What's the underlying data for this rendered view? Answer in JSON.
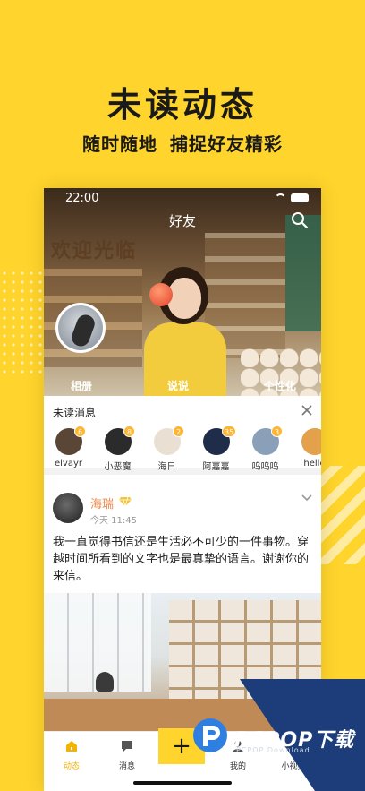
{
  "hero": {
    "title": "未读动态",
    "subtitle_left": "随时随地",
    "subtitle_right": "捕捉好友精彩"
  },
  "status_bar": {
    "time": "22:00"
  },
  "header": {
    "title": "好友",
    "sign_text": "欢迎光临",
    "tabs": [
      "相册",
      "说说",
      "个性化"
    ]
  },
  "unread": {
    "title": "未读消息",
    "friends": [
      {
        "name": "elvayr",
        "count": "6",
        "color": "#5a4636"
      },
      {
        "name": "小恶魔",
        "count": "8",
        "color": "#2b2b2b"
      },
      {
        "name": "海日",
        "count": "2",
        "color": "#e9e0d3"
      },
      {
        "name": "阿嘉嘉",
        "count": "35",
        "color": "#1f2d4a"
      },
      {
        "name": "呜呜呜",
        "count": "3",
        "color": "#8aa0b8"
      },
      {
        "name": "hello",
        "count": "",
        "color": "#e2a14a"
      }
    ]
  },
  "post": {
    "author": "海瑞",
    "time": "今天 11:45",
    "text": "我一直觉得书信还是生活必不可少的一件事物。穿越时间所看到的文字也是最真挚的语言。谢谢你的来信。"
  },
  "tabbar": {
    "items": [
      "动态",
      "消息",
      "+",
      "我的",
      "小视频"
    ],
    "active_color": "#F3B400"
  },
  "watermark": {
    "brand": "PCPOP下载",
    "sub": "PCPOP Download"
  },
  "colors": {
    "background": "#FFD42C",
    "accent_name": "#F08A4B",
    "badge": "#FFB62E"
  }
}
